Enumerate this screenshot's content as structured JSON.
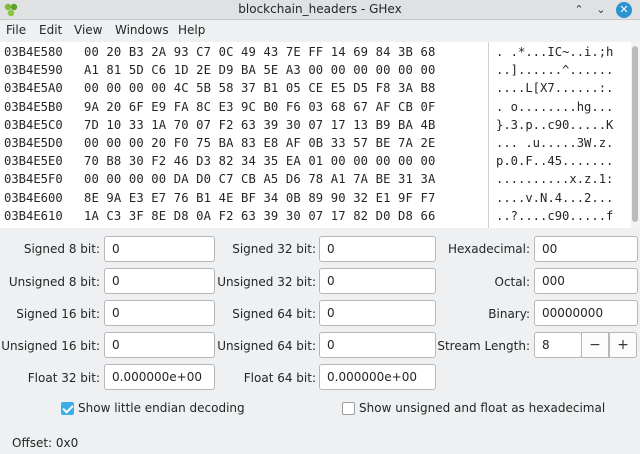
{
  "window": {
    "title": "blockchain_headers - GHex",
    "minimize_glyph": "⌃",
    "maximize_glyph": "⌄",
    "close_glyph": "✕"
  },
  "menu": [
    "File",
    "Edit",
    "View",
    "Windows",
    "Help"
  ],
  "hex_rows": [
    {
      "addr": "03B4E580",
      "hex": "00 20 B3 2A 93 C7 0C 49 43 7E FF 14 69 84 3B 68",
      "ascii": ". .*...IC~..i.;h"
    },
    {
      "addr": "03B4E590",
      "hex": "A1 81 5D C6 1D 2E D9 BA 5E A3 00 00 00 00 00 00",
      "ascii": "..]......^......"
    },
    {
      "addr": "03B4E5A0",
      "hex": "00 00 00 00 4C 5B 58 37 B1 05 CE E5 D5 F8 3A B8",
      "ascii": "....L[X7......:."
    },
    {
      "addr": "03B4E5B0",
      "hex": "9A 20 6F E9 FA 8C E3 9C B0 F6 03 68 67 AF CB 0F",
      "ascii": ". o........hg..."
    },
    {
      "addr": "03B4E5C0",
      "hex": "7D 10 33 1A 70 07 F2 63 39 30 07 17 13 B9 BA 4B",
      "ascii": "}.3.p..c90.....K"
    },
    {
      "addr": "03B4E5D0",
      "hex": "00 00 00 20 F0 75 BA 83 E8 AF 0B 33 57 BE 7A 2E",
      "ascii": "... .u.....3W.z."
    },
    {
      "addr": "03B4E5E0",
      "hex": "70 B8 30 F2 46 D3 82 34 35 EA 01 00 00 00 00 00",
      "ascii": "p.0.F..45......."
    },
    {
      "addr": "03B4E5F0",
      "hex": "00 00 00 00 DA D0 C7 CB A5 D6 78 A1 7A BE 31 3A",
      "ascii": "..........x.z.1:"
    },
    {
      "addr": "03B4E600",
      "hex": "8E 9A E3 E7 76 B1 4E BF 34 0B 89 90 32 E1 9F F7",
      "ascii": "....v.N.4...2..."
    },
    {
      "addr": "03B4E610",
      "hex": "1A C3 3F 8E D8 0A F2 63 39 30 07 17 82 D0 D8 66",
      "ascii": "..?....c90.....f"
    }
  ],
  "fields": {
    "signed8": {
      "label": "Signed 8 bit:",
      "value": "0"
    },
    "unsigned8": {
      "label": "Unsigned 8 bit:",
      "value": "0"
    },
    "signed16": {
      "label": "Signed 16 bit:",
      "value": "0"
    },
    "unsigned16": {
      "label": "Unsigned 16 bit:",
      "value": "0"
    },
    "float32": {
      "label": "Float 32 bit:",
      "value": "0.000000e+00"
    },
    "signed32": {
      "label": "Signed 32 bit:",
      "value": "0"
    },
    "unsigned32": {
      "label": "Unsigned 32 bit:",
      "value": "0"
    },
    "signed64": {
      "label": "Signed 64 bit:",
      "value": "0"
    },
    "unsigned64": {
      "label": "Unsigned 64 bit:",
      "value": "0"
    },
    "float64": {
      "label": "Float 64 bit:",
      "value": "0.000000e+00"
    },
    "hexadecimal": {
      "label": "Hexadecimal:",
      "value": "00"
    },
    "octal": {
      "label": "Octal:",
      "value": "000"
    },
    "binary": {
      "label": "Binary:",
      "value": "00000000"
    },
    "stream_length": {
      "label": "Stream Length:",
      "value": "8",
      "minus": "−",
      "plus": "+"
    }
  },
  "options": {
    "little_endian": {
      "label": "Show little endian decoding",
      "checked": true
    },
    "unsigned_hex": {
      "label": "Show unsigned and float as hexadecimal",
      "checked": false
    }
  },
  "status": {
    "offset": "Offset: 0x0"
  },
  "colors": {
    "accent": "#3daee9",
    "close_button": "#2a93d0"
  }
}
